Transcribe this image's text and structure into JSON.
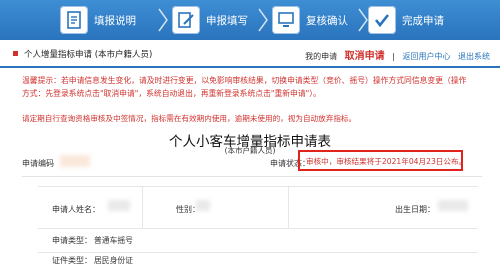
{
  "steps": [
    {
      "label": "填报说明"
    },
    {
      "label": "申报填写"
    },
    {
      "label": "复核确认"
    },
    {
      "label": "完成申请"
    }
  ],
  "breadcrumb": {
    "title": "个人增量指标申请 (本市户籍人员)"
  },
  "links": {
    "my_apply": "我的申请",
    "cancel": "取消申请",
    "separator": "|",
    "user_center": "返回用户中心",
    "logout": "退出系统"
  },
  "notice": {
    "line1": "温馨提示：若申请信息发生变化，请及时进行变更，以免影响审核结果，切换申请类型（竞价、摇号）操作方式同信息变更（操作",
    "line2": "方式：先登录系统点击\"取消申请\"，系统自动退出，再重新登录系统点击\"重新申请\"）。",
    "line3": "请定期自行查询资格审核及中签情况，指标需在有效期内使用，逾期未使用的，视为自动放弃指标。"
  },
  "form": {
    "title": "个人小客车增量指标申请表",
    "subtitle": "(本市户籍人员)",
    "code_label": "申请编码",
    "status_label": "申请状态：",
    "status_value": "审核中，审核结果将于2021年04月23日公布。",
    "applicant_label": "申请人姓名：",
    "gender_label": "性别：",
    "birth_label": "出生日期：",
    "type_label": "申请类型：",
    "type_value": "普通车摇号",
    "id_type_label": "证件类型：",
    "id_type_value": "居民身份证"
  },
  "colors": {
    "brand": "#2a74bd",
    "alert": "#d0312d",
    "highlight_box": "#e0241c"
  }
}
